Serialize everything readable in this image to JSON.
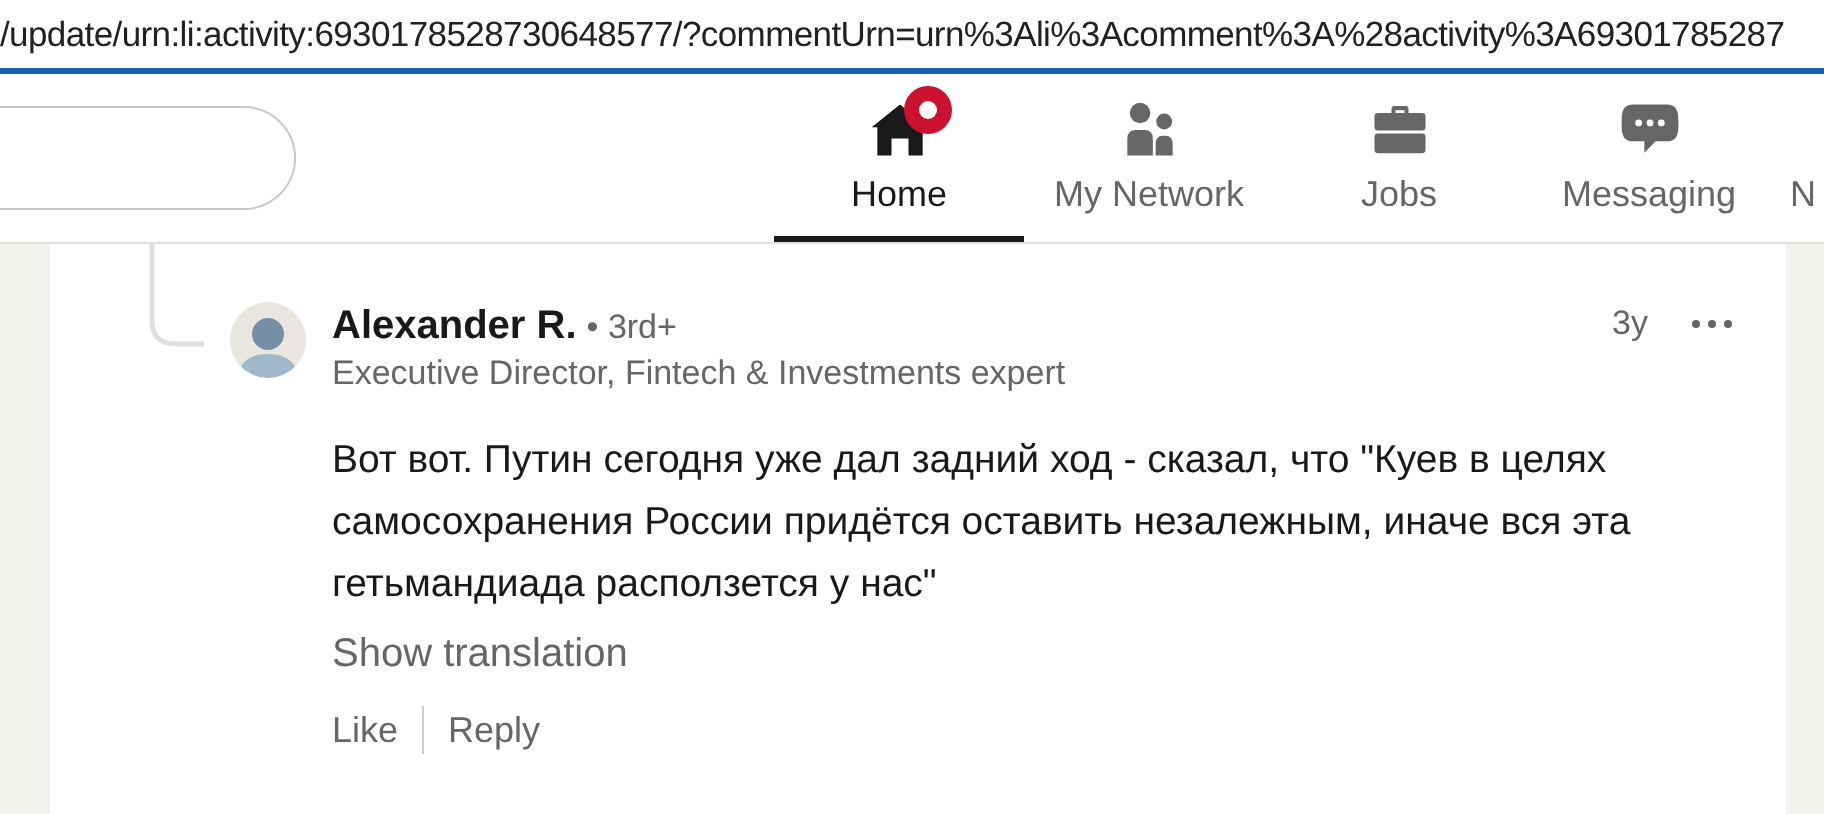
{
  "address_bar": {
    "url": "/update/urn:li:activity:6930178528730648577/?commentUrn=urn%3Ali%3Acomment%3A%28activity%3A69301785287"
  },
  "nav": {
    "items": [
      {
        "kind": "home",
        "label": "Home",
        "selected": true,
        "notification": true
      },
      {
        "kind": "network",
        "label": "My Network",
        "selected": false,
        "notification": false
      },
      {
        "kind": "jobs",
        "label": "Jobs",
        "selected": false,
        "notification": false
      },
      {
        "kind": "messaging",
        "label": "Messaging",
        "selected": false,
        "notification": false
      },
      {
        "kind": "cut",
        "label": "N",
        "selected": false,
        "notification": false
      }
    ]
  },
  "comment": {
    "author": "Alexander R.",
    "degree": "• 3rd+",
    "headline": "Executive Director, Fintech & Investments expert",
    "time": "3y",
    "body": "Вот вот. Путин сегодня уже дал задний ход - сказал, что \"Куев в целях самосохранения России придётся оставить незалежным, иначе вся эта гетьмандиада расползется у нас\"",
    "show_translation": "Show translation",
    "actions": [
      "Like",
      "Reply"
    ]
  }
}
